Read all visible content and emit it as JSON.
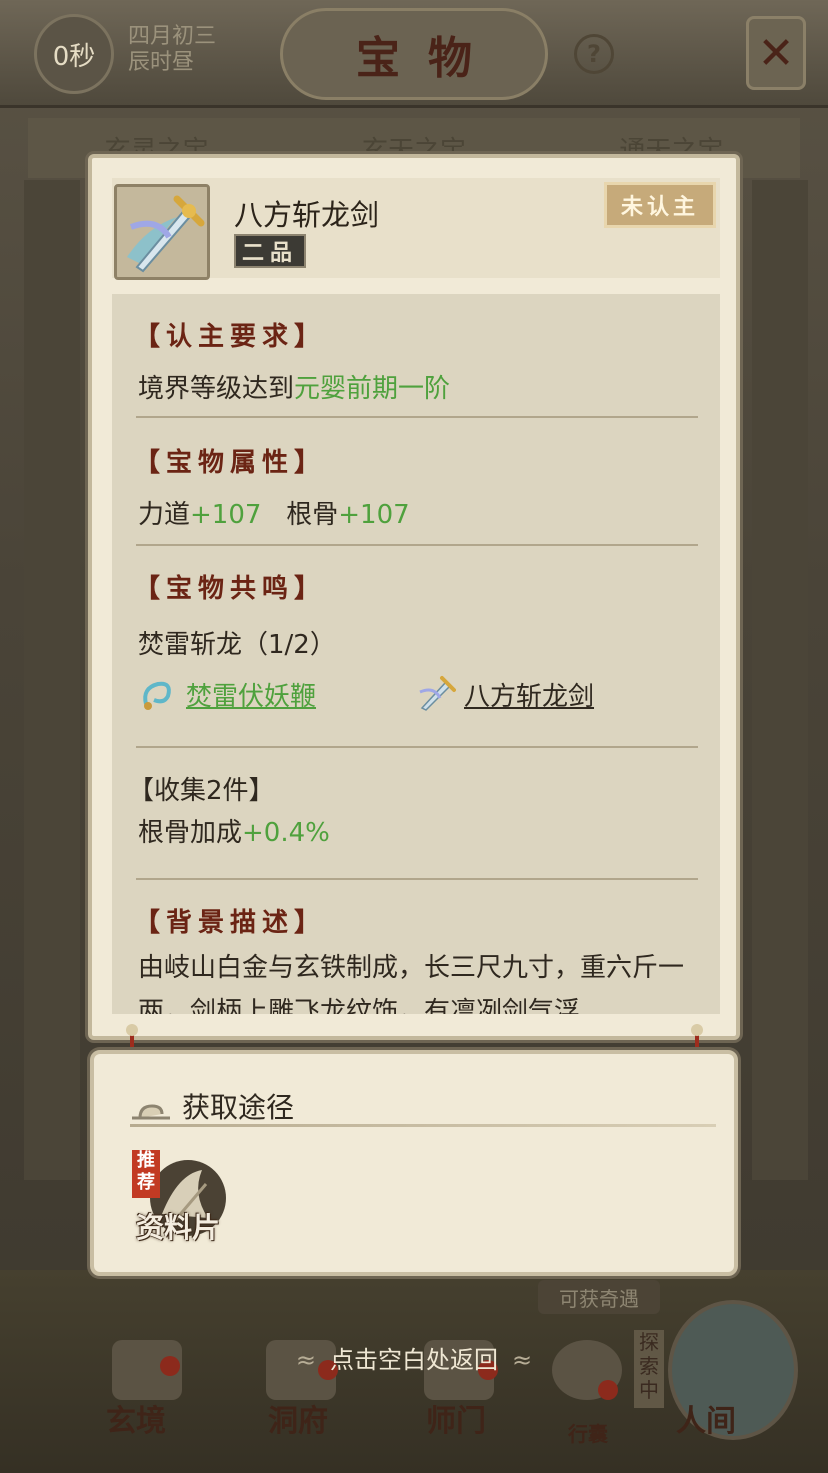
{
  "header": {
    "timer": "0秒",
    "date_line1": "四月初三",
    "date_line2": "辰时昼",
    "title": "宝物",
    "help": "?",
    "close": "✕"
  },
  "background_tabs": [
    "玄灵之宝",
    "玄天之宝",
    "通天之宝"
  ],
  "item": {
    "name": "八方斩龙剑",
    "grade": "二品",
    "bind_status": "未认主"
  },
  "requirement": {
    "title": "【认主要求】",
    "prefix": "境界等级达到",
    "value": "元婴前期一阶"
  },
  "attributes": {
    "title": "【宝物属性】",
    "stats": [
      {
        "name": "力道",
        "value": "+107"
      },
      {
        "name": "根骨",
        "value": "+107"
      }
    ]
  },
  "resonance": {
    "title": "【宝物共鸣】",
    "set_name": "焚雷斩龙（1/2）",
    "items": [
      {
        "name": "焚雷伏妖鞭",
        "owned": true
      },
      {
        "name": "八方斩龙剑",
        "owned": false
      }
    ],
    "bonus_title": "【收集2件】",
    "bonus_prefix": "根骨加成",
    "bonus_value": "+0.4%"
  },
  "background": {
    "title": "【背景描述】",
    "text": "由岐山白金与玄铁制成，长三尺九寸，重六斤一两，剑柄上雕飞龙纹饰，有凛冽剑气浮"
  },
  "acquire": {
    "title": "获取途径",
    "tag": "推荐",
    "source": "资料片"
  },
  "hint": "点击空白处返回",
  "bottom": {
    "chance": "可获奇遇",
    "explore_tag": "探索中",
    "nav": [
      "玄境",
      "洞府",
      "师门",
      "行囊",
      "人间"
    ]
  },
  "colors": {
    "highlight_green": "#4fa13d",
    "section_red": "#6b2414",
    "panel_bg": "#f1ead7"
  }
}
